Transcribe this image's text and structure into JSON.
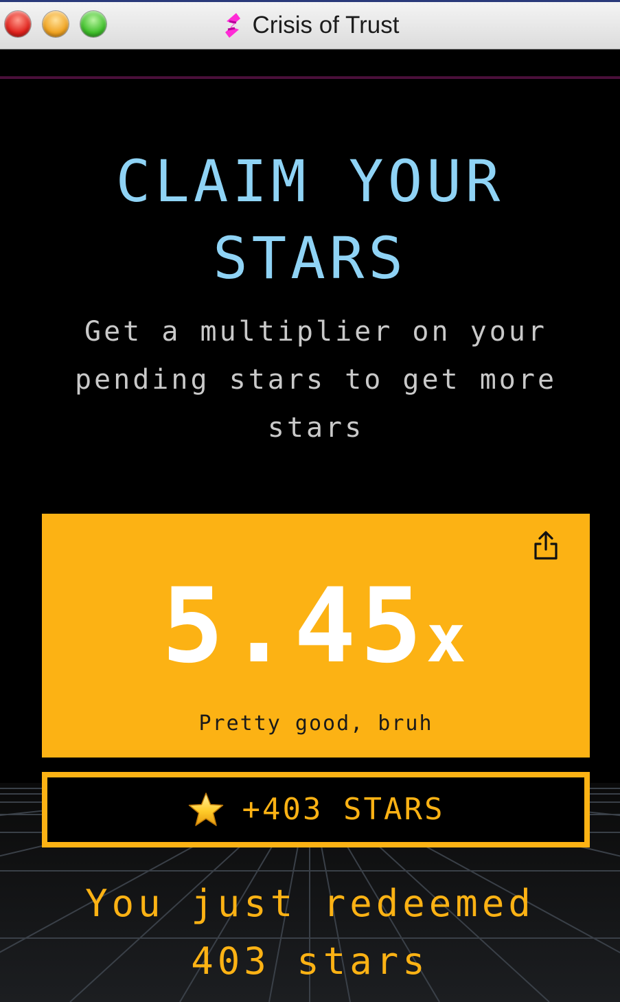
{
  "window": {
    "title": "Crisis of Trust",
    "buttons": [
      "close",
      "minimize",
      "maximize"
    ],
    "app_icon": "app-logo-icon"
  },
  "colors": {
    "background": "#000000",
    "headline": "#8fd3f5",
    "subtext": "#c9c9c9",
    "accent_yellow": "#fcb214",
    "accent_line": "#4a0f3a"
  },
  "page": {
    "headline": "CLAIM YOUR STARS",
    "subheadline": "Get a multiplier on your pending stars to get more stars",
    "multiplier": {
      "value": "5.45",
      "suffix": "x",
      "caption": "Pretty good, bruh",
      "share_icon": "share-icon"
    },
    "claim_button": {
      "icon": "star-icon",
      "label": "+403 STARS"
    },
    "redeemed_message": "You just redeemed 403 stars"
  }
}
